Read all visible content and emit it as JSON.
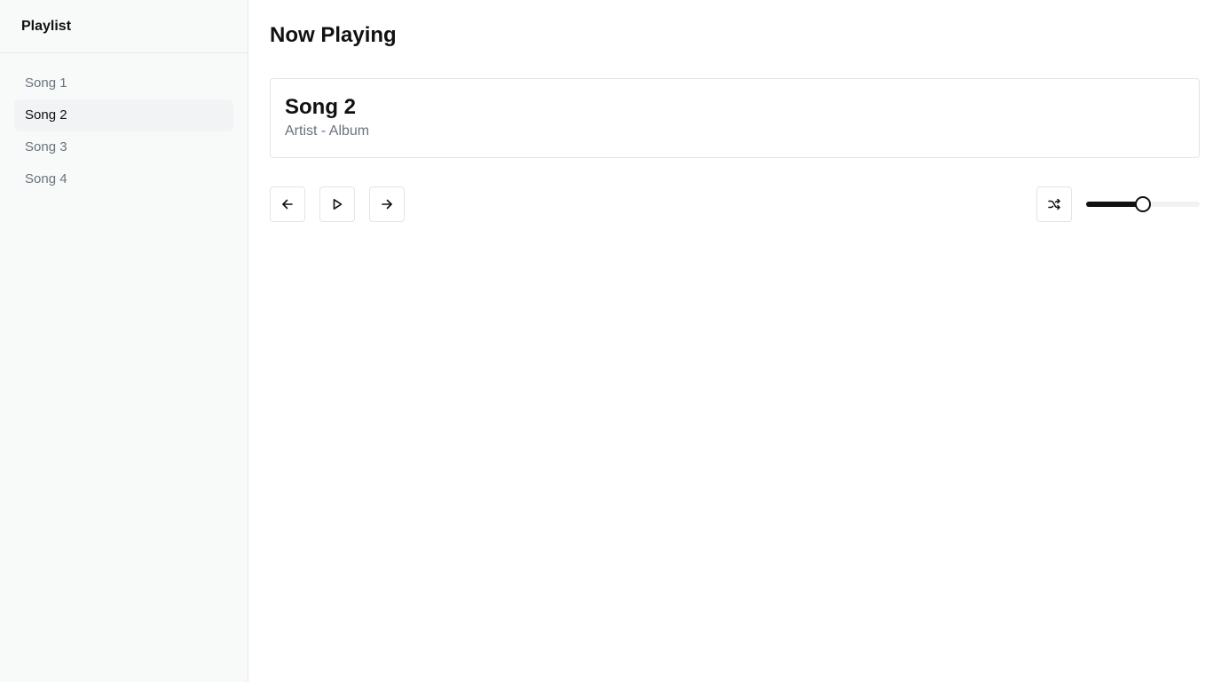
{
  "sidebar": {
    "title": "Playlist",
    "items": [
      {
        "label": "Song 1",
        "active": false
      },
      {
        "label": "Song 2",
        "active": true
      },
      {
        "label": "Song 3",
        "active": false
      },
      {
        "label": "Song 4",
        "active": false
      }
    ]
  },
  "main": {
    "title": "Now Playing",
    "now_playing": {
      "song": "Song 2",
      "meta": "Artist - Album"
    },
    "controls": {
      "previous_icon": "arrow-left-icon",
      "play_icon": "play-icon",
      "next_icon": "arrow-right-icon",
      "shuffle_icon": "shuffle-icon",
      "volume_level": 0.5
    }
  },
  "colors": {
    "accent": "#111111",
    "muted_text": "#6b7280",
    "sidebar_bg": "#f8faf9",
    "active_item_bg": "#f1f3f5",
    "border": "#e2e4e7"
  }
}
